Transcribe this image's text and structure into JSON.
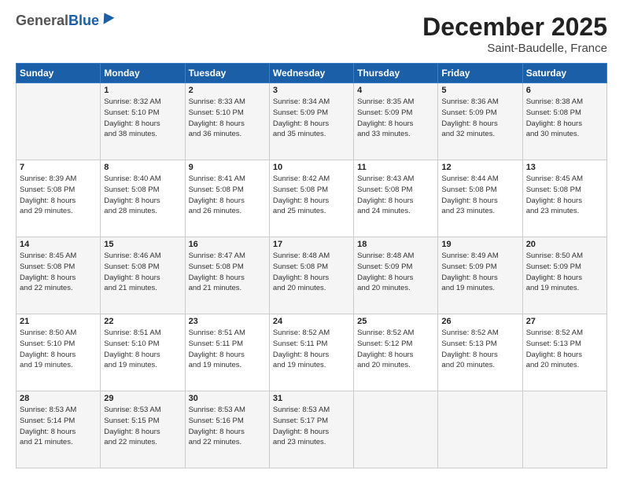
{
  "header": {
    "logo_general": "General",
    "logo_blue": "Blue",
    "month_title": "December 2025",
    "location": "Saint-Baudelle, France"
  },
  "days_of_week": [
    "Sunday",
    "Monday",
    "Tuesday",
    "Wednesday",
    "Thursday",
    "Friday",
    "Saturday"
  ],
  "weeks": [
    [
      {
        "day": "",
        "sunrise": "",
        "sunset": "",
        "daylight": ""
      },
      {
        "day": "1",
        "sunrise": "Sunrise: 8:32 AM",
        "sunset": "Sunset: 5:10 PM",
        "daylight": "Daylight: 8 hours and 38 minutes."
      },
      {
        "day": "2",
        "sunrise": "Sunrise: 8:33 AM",
        "sunset": "Sunset: 5:10 PM",
        "daylight": "Daylight: 8 hours and 36 minutes."
      },
      {
        "day": "3",
        "sunrise": "Sunrise: 8:34 AM",
        "sunset": "Sunset: 5:09 PM",
        "daylight": "Daylight: 8 hours and 35 minutes."
      },
      {
        "day": "4",
        "sunrise": "Sunrise: 8:35 AM",
        "sunset": "Sunset: 5:09 PM",
        "daylight": "Daylight: 8 hours and 33 minutes."
      },
      {
        "day": "5",
        "sunrise": "Sunrise: 8:36 AM",
        "sunset": "Sunset: 5:09 PM",
        "daylight": "Daylight: 8 hours and 32 minutes."
      },
      {
        "day": "6",
        "sunrise": "Sunrise: 8:38 AM",
        "sunset": "Sunset: 5:08 PM",
        "daylight": "Daylight: 8 hours and 30 minutes."
      }
    ],
    [
      {
        "day": "7",
        "sunrise": "Sunrise: 8:39 AM",
        "sunset": "Sunset: 5:08 PM",
        "daylight": "Daylight: 8 hours and 29 minutes."
      },
      {
        "day": "8",
        "sunrise": "Sunrise: 8:40 AM",
        "sunset": "Sunset: 5:08 PM",
        "daylight": "Daylight: 8 hours and 28 minutes."
      },
      {
        "day": "9",
        "sunrise": "Sunrise: 8:41 AM",
        "sunset": "Sunset: 5:08 PM",
        "daylight": "Daylight: 8 hours and 26 minutes."
      },
      {
        "day": "10",
        "sunrise": "Sunrise: 8:42 AM",
        "sunset": "Sunset: 5:08 PM",
        "daylight": "Daylight: 8 hours and 25 minutes."
      },
      {
        "day": "11",
        "sunrise": "Sunrise: 8:43 AM",
        "sunset": "Sunset: 5:08 PM",
        "daylight": "Daylight: 8 hours and 24 minutes."
      },
      {
        "day": "12",
        "sunrise": "Sunrise: 8:44 AM",
        "sunset": "Sunset: 5:08 PM",
        "daylight": "Daylight: 8 hours and 23 minutes."
      },
      {
        "day": "13",
        "sunrise": "Sunrise: 8:45 AM",
        "sunset": "Sunset: 5:08 PM",
        "daylight": "Daylight: 8 hours and 23 minutes."
      }
    ],
    [
      {
        "day": "14",
        "sunrise": "Sunrise: 8:45 AM",
        "sunset": "Sunset: 5:08 PM",
        "daylight": "Daylight: 8 hours and 22 minutes."
      },
      {
        "day": "15",
        "sunrise": "Sunrise: 8:46 AM",
        "sunset": "Sunset: 5:08 PM",
        "daylight": "Daylight: 8 hours and 21 minutes."
      },
      {
        "day": "16",
        "sunrise": "Sunrise: 8:47 AM",
        "sunset": "Sunset: 5:08 PM",
        "daylight": "Daylight: 8 hours and 21 minutes."
      },
      {
        "day": "17",
        "sunrise": "Sunrise: 8:48 AM",
        "sunset": "Sunset: 5:08 PM",
        "daylight": "Daylight: 8 hours and 20 minutes."
      },
      {
        "day": "18",
        "sunrise": "Sunrise: 8:48 AM",
        "sunset": "Sunset: 5:09 PM",
        "daylight": "Daylight: 8 hours and 20 minutes."
      },
      {
        "day": "19",
        "sunrise": "Sunrise: 8:49 AM",
        "sunset": "Sunset: 5:09 PM",
        "daylight": "Daylight: 8 hours and 19 minutes."
      },
      {
        "day": "20",
        "sunrise": "Sunrise: 8:50 AM",
        "sunset": "Sunset: 5:09 PM",
        "daylight": "Daylight: 8 hours and 19 minutes."
      }
    ],
    [
      {
        "day": "21",
        "sunrise": "Sunrise: 8:50 AM",
        "sunset": "Sunset: 5:10 PM",
        "daylight": "Daylight: 8 hours and 19 minutes."
      },
      {
        "day": "22",
        "sunrise": "Sunrise: 8:51 AM",
        "sunset": "Sunset: 5:10 PM",
        "daylight": "Daylight: 8 hours and 19 minutes."
      },
      {
        "day": "23",
        "sunrise": "Sunrise: 8:51 AM",
        "sunset": "Sunset: 5:11 PM",
        "daylight": "Daylight: 8 hours and 19 minutes."
      },
      {
        "day": "24",
        "sunrise": "Sunrise: 8:52 AM",
        "sunset": "Sunset: 5:11 PM",
        "daylight": "Daylight: 8 hours and 19 minutes."
      },
      {
        "day": "25",
        "sunrise": "Sunrise: 8:52 AM",
        "sunset": "Sunset: 5:12 PM",
        "daylight": "Daylight: 8 hours and 20 minutes."
      },
      {
        "day": "26",
        "sunrise": "Sunrise: 8:52 AM",
        "sunset": "Sunset: 5:13 PM",
        "daylight": "Daylight: 8 hours and 20 minutes."
      },
      {
        "day": "27",
        "sunrise": "Sunrise: 8:52 AM",
        "sunset": "Sunset: 5:13 PM",
        "daylight": "Daylight: 8 hours and 20 minutes."
      }
    ],
    [
      {
        "day": "28",
        "sunrise": "Sunrise: 8:53 AM",
        "sunset": "Sunset: 5:14 PM",
        "daylight": "Daylight: 8 hours and 21 minutes."
      },
      {
        "day": "29",
        "sunrise": "Sunrise: 8:53 AM",
        "sunset": "Sunset: 5:15 PM",
        "daylight": "Daylight: 8 hours and 22 minutes."
      },
      {
        "day": "30",
        "sunrise": "Sunrise: 8:53 AM",
        "sunset": "Sunset: 5:16 PM",
        "daylight": "Daylight: 8 hours and 22 minutes."
      },
      {
        "day": "31",
        "sunrise": "Sunrise: 8:53 AM",
        "sunset": "Sunset: 5:17 PM",
        "daylight": "Daylight: 8 hours and 23 minutes."
      },
      {
        "day": "",
        "sunrise": "",
        "sunset": "",
        "daylight": ""
      },
      {
        "day": "",
        "sunrise": "",
        "sunset": "",
        "daylight": ""
      },
      {
        "day": "",
        "sunrise": "",
        "sunset": "",
        "daylight": ""
      }
    ]
  ]
}
